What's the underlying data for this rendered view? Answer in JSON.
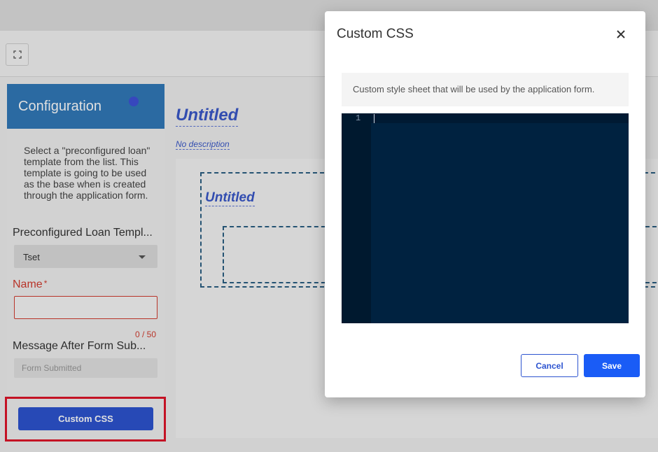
{
  "sidebar": {
    "title": "Configuration",
    "help_text": "Select a \"preconfigured loan\" template from the list. This template is going to be used as the base when is created through the application form.",
    "template_label": "Preconfigured Loan Templ...",
    "template_value": "Tset",
    "name_label": "Name",
    "name_required": "*",
    "name_value": "",
    "name_counter": "0 / 50",
    "message_label": "Message After Form Sub...",
    "message_placeholder": "Form Submitted",
    "custom_css_button": "Custom CSS"
  },
  "canvas": {
    "form_title": "Untitled",
    "form_description": "No description",
    "section_title": "Untitled"
  },
  "modal": {
    "title": "Custom CSS",
    "description": "Custom style sheet that will be used by the application form.",
    "editor_line_numbers": [
      "1"
    ],
    "cancel_label": "Cancel",
    "save_label": "Save"
  },
  "icons": {
    "toolbar": "expand-icon",
    "close": "close-icon",
    "dropdown": "chevron-down-icon"
  },
  "colors": {
    "sidebar_header": "#3179b9",
    "primary_button": "#2d54d0",
    "save_button": "#1a5cf6",
    "editor_bg": "#002240",
    "error": "#d23c2f",
    "highlight": "#e0152a"
  }
}
